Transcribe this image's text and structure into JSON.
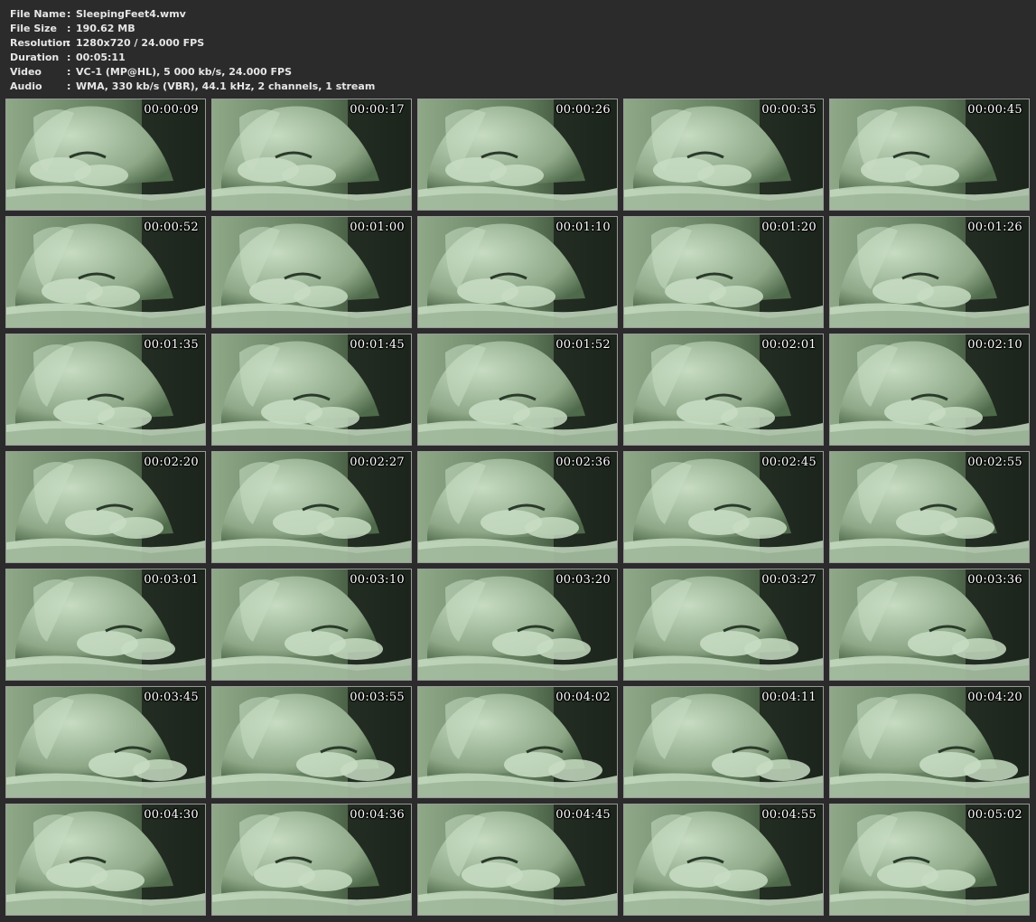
{
  "info": [
    {
      "key": "File Name",
      "value": "SleepingFeet4.wmv"
    },
    {
      "key": "File Size",
      "value": "190.62 MB"
    },
    {
      "key": "Resolution",
      "value": "1280x720 / 24.000 FPS"
    },
    {
      "key": "Duration",
      "value": "00:05:11"
    },
    {
      "key": "Video",
      "value": "VC-1 (MP@HL), 5 000 kb/s, 24.000 FPS"
    },
    {
      "key": "Audio",
      "value": "WMA, 330 kb/s (VBR), 44.1 kHz, 2 channels, 1 stream"
    }
  ],
  "separator": ":",
  "thumbnails": [
    "00:00:09",
    "00:00:17",
    "00:00:26",
    "00:00:35",
    "00:00:45",
    "00:00:52",
    "00:01:00",
    "00:01:10",
    "00:01:20",
    "00:01:26",
    "00:01:35",
    "00:01:45",
    "00:01:52",
    "00:02:01",
    "00:02:10",
    "00:02:20",
    "00:02:27",
    "00:02:36",
    "00:02:45",
    "00:02:55",
    "00:03:01",
    "00:03:10",
    "00:03:20",
    "00:03:27",
    "00:03:36",
    "00:03:45",
    "00:03:55",
    "00:04:02",
    "00:04:11",
    "00:04:20",
    "00:04:30",
    "00:04:36",
    "00:04:45",
    "00:04:55",
    "00:05:02"
  ],
  "colors": {
    "background": "#2b2b2b",
    "text": "#e6e6e6",
    "thumb_border": "#9a9a9a",
    "tint_light": "#c7dcc2",
    "tint_mid": "#8ea888",
    "tint_dark": "#1c251c"
  }
}
